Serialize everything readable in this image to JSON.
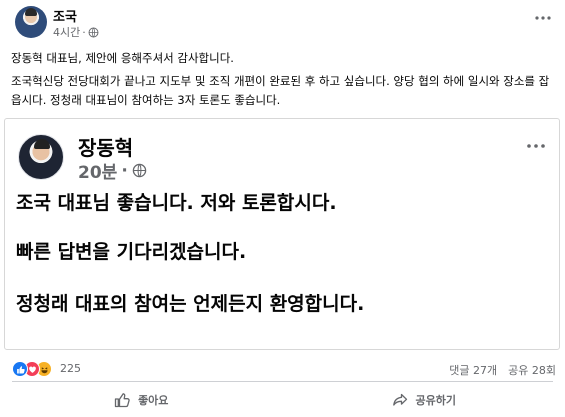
{
  "post": {
    "author": "조국",
    "time": "4시간",
    "body": [
      "장동혁 대표님, 제안에 응해주셔서 감사합니다.",
      "조국혁신당 전당대회가 끝나고 지도부 및 조직 개편이 완료된 후 하고 싶습니다. 양당 협의 하에 일시와 장소를 잡읍시다. 정청래 대표님이 참여하는 3자 토론도 좋습니다."
    ]
  },
  "shared_post": {
    "author": "장동혁",
    "time": "20분",
    "lines": [
      "조국 대표님 좋습니다. 저와 토론합시다.",
      "빠른 답변을 기다리겠습니다.",
      "정청래 대표의 참여는 언제든지 환영합니다."
    ]
  },
  "reactions": {
    "icons": [
      "like-icon",
      "love-icon",
      "haha-icon"
    ],
    "count": "225"
  },
  "counts": {
    "comments": "댓글 27개",
    "shares": "공유 28회"
  },
  "actions": {
    "like_label": "좋아요",
    "share_label": "공유하기"
  },
  "colors": {
    "like_blue": "#1877f2",
    "love_red": "#f33e58",
    "haha_yellow": "#f7b125",
    "secondary_text": "#65676b"
  }
}
